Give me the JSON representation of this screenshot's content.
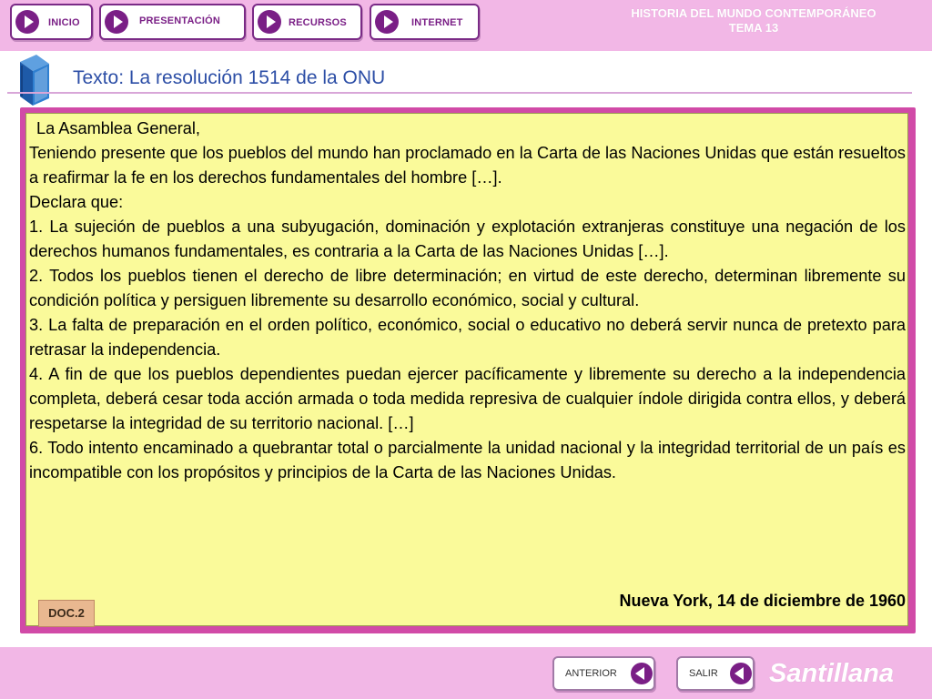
{
  "nav": {
    "items": [
      {
        "label": "INICIO"
      },
      {
        "label": "PRESENTACIÓN"
      },
      {
        "label": "RECURSOS"
      },
      {
        "label": "INTERNET"
      }
    ]
  },
  "header": {
    "course": "HISTORIA DEL MUNDO CONTEMPORÁNEO",
    "unit": "TEMA 13"
  },
  "page": {
    "title": "Texto: La resolución 1514 de la ONU",
    "icon": "book-icon"
  },
  "document": {
    "paragraphs": [
      "La Asamblea General,",
      "Teniendo presente que los pueblos del mundo han proclamado en la Carta de las Naciones Unidas que están resueltos a reafirmar la fe en los derechos fundamentales del hombre […].",
      "Declara que:",
      "1. La sujeción de pueblos a una subyugación, dominación y explotación extranjeras constituye una negación de los derechos humanos fundamentales, es contraria a la Carta de las Naciones Unidas […].",
      "2. Todos los pueblos tienen el derecho de libre determinación; en virtud de este derecho, determinan libremente su condición política y persiguen libremente su desarrollo económico, social y cultural.",
      "3. La falta de preparación en el orden político, económico, social o educativo no deberá servir nunca de pretexto para retrasar la independencia.",
      "4. A fin de que los pueblos dependientes puedan ejercer pacíficamente y libremente su derecho a la independencia completa, deberá cesar toda acción armada o toda medida represiva de cualquier índole dirigida contra ellos, y deberá respetarse la integridad de su territorio nacional. […]",
      "6. Todo intento encaminado a quebrantar total o parcialmente la unidad nacional y la integridad territorial de un país es incompatible con los propósitos y principios de la Carta de las Naciones Unidas."
    ],
    "date": "Nueva York, 14 de diciembre de 1960",
    "badge": "DOC.2"
  },
  "footer": {
    "previous_label": "ANTERIOR",
    "exit_label": "SALIR",
    "brand": "Santillana"
  },
  "colors": {
    "bar_pink": "#f2b7e6",
    "accent_purple": "#7a1f86",
    "title_blue": "#2c4ea6",
    "panel_border": "#d14aa7",
    "panel_fill": "#fafa9a"
  }
}
